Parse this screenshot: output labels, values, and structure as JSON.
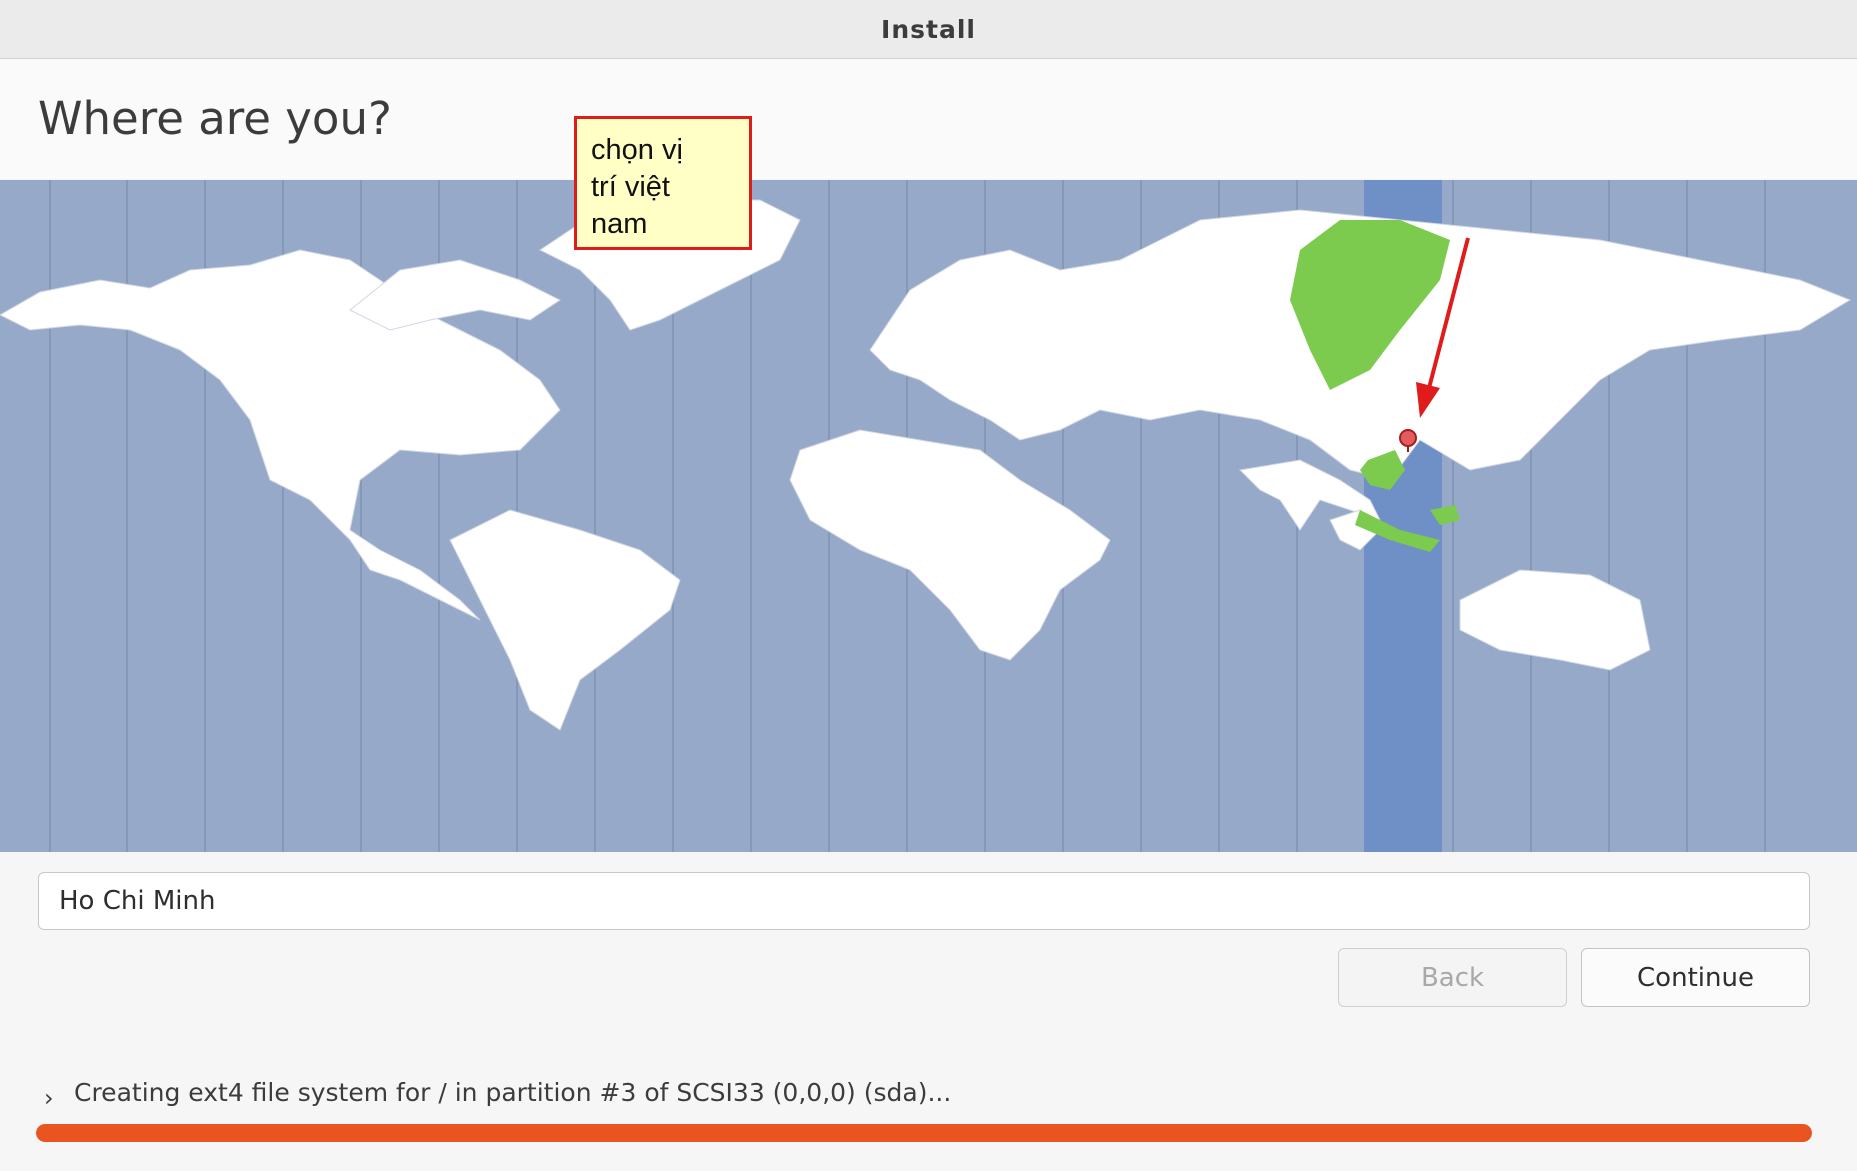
{
  "window": {
    "title": "Install"
  },
  "page": {
    "title": "Where are you?"
  },
  "annotation": {
    "lines": [
      "chọn vị",
      "trí việt",
      "nam"
    ]
  },
  "location": {
    "value": "Ho Chi Minh",
    "selected_city_marker": "map-pin-icon"
  },
  "buttons": {
    "back": "Back",
    "continue": "Continue"
  },
  "status": {
    "text": "Creating ext4 file system for / in partition #3 of SCSI33 (0,0,0) (sda)...",
    "progress": 1.0
  },
  "colors": {
    "accent": "#e95420",
    "ocean": "#96a9c9",
    "selected_timezone": "#6f8fc7",
    "land": "#ffffff",
    "selected_country": "#7ccb4e",
    "annotation_border": "#e01b1b"
  },
  "icons": {
    "expander": "chevron-right-icon",
    "pointer": "red-arrow-icon"
  }
}
